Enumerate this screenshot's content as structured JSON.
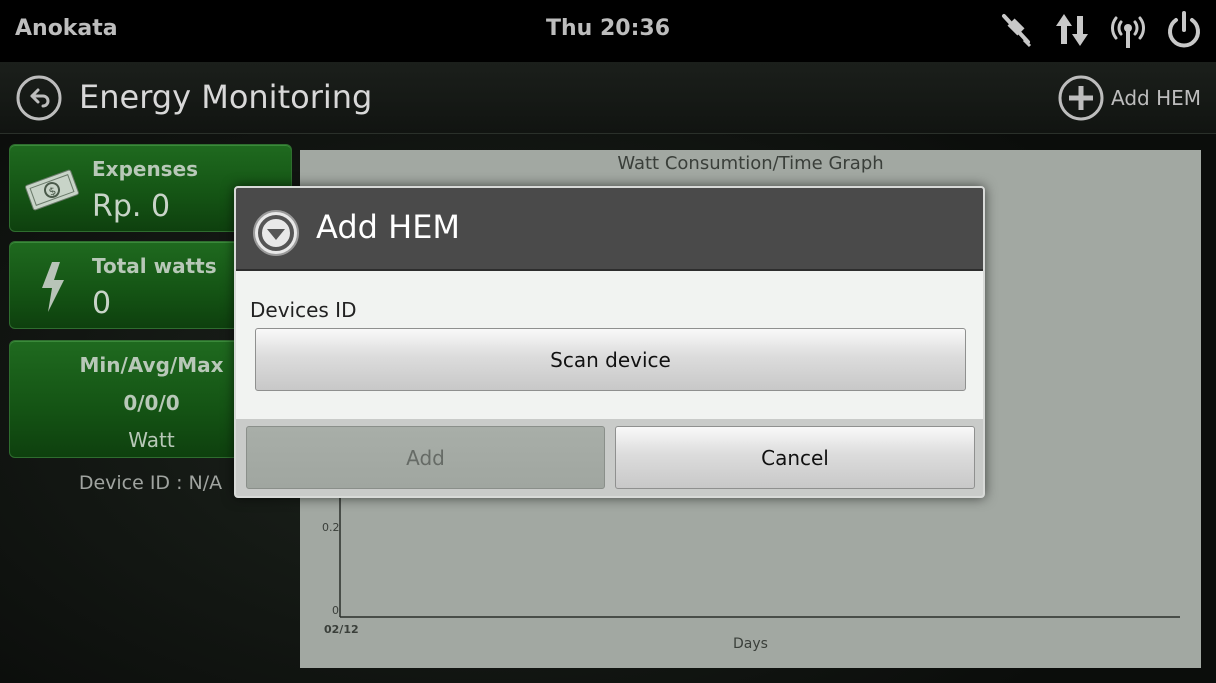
{
  "status_bar": {
    "app_name": "Anokata",
    "time": "Thu 20:36",
    "icons": [
      "satellite-icon",
      "data-transfer-icon",
      "wireless-icon",
      "power-icon"
    ]
  },
  "action_bar": {
    "title": "Energy Monitoring",
    "add_button_label": "Add HEM"
  },
  "cards": {
    "expenses": {
      "label": "Expenses",
      "value": "Rp. 0",
      "icon": "money-icon"
    },
    "total_watts": {
      "label": "Total watts",
      "value": "0",
      "icon": "lightning-icon"
    },
    "min_avg_max": {
      "label": "Min/Avg/Max",
      "value": "0/0/0",
      "unit": "Watt"
    },
    "device_id": "Device ID : N/A"
  },
  "graph": {
    "title": "Watt Consumtion/Time Graph",
    "xlabel": "Days"
  },
  "chart_data": {
    "type": "line",
    "title": "Watt Consumtion/Time Graph",
    "xlabel": "Days",
    "ylabel": "",
    "categories": [
      "02/12"
    ],
    "y_ticks": [
      "0.2",
      "0"
    ],
    "series": [],
    "grid": false
  },
  "dialog": {
    "title": "Add HEM",
    "field_label": "Devices ID",
    "scan_button": "Scan device",
    "add_button": "Add",
    "cancel_button": "Cancel"
  },
  "colors": {
    "card_green": "#1a5f1a",
    "dialog_header": "#4a4a4a",
    "graph_bg": "#a2a8a2"
  }
}
